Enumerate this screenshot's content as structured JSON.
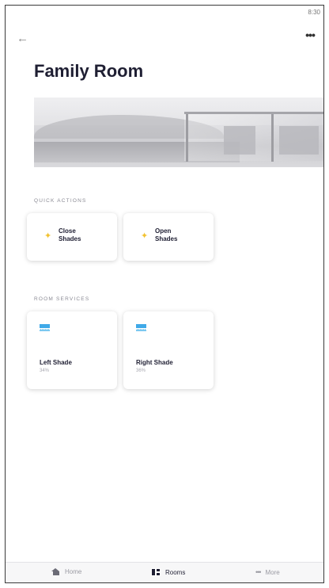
{
  "status": {
    "time": "8:30"
  },
  "header": {
    "back_icon": "arrow-left-icon",
    "title": "Family Room",
    "more_glyph": "•••"
  },
  "quick_actions": {
    "label": "QUICK ACTIONS",
    "items": [
      {
        "line1": "Close",
        "line2": "Shades",
        "icon": "lightning-bolt-icon"
      },
      {
        "line1": "Open",
        "line2": "Shades",
        "icon": "lightning-bolt-icon"
      }
    ]
  },
  "room_services": {
    "label": "ROOM SERVICES",
    "items": [
      {
        "name": "Left Shade",
        "value": "34%",
        "icon": "window-shade-icon"
      },
      {
        "name": "Right Shade",
        "value": "36%",
        "icon": "window-shade-icon"
      }
    ]
  },
  "tabbar": {
    "items": [
      {
        "label": "Home",
        "icon": "home-icon"
      },
      {
        "label": "Rooms",
        "icon": "rooms-icon"
      },
      {
        "label": "More",
        "icon": "more-dots-icon"
      }
    ],
    "active": "Rooms"
  },
  "colors": {
    "accent_blue": "#3fa9e8",
    "bolt_yellow": "#f2c230",
    "title_dark": "#1f1f33"
  }
}
